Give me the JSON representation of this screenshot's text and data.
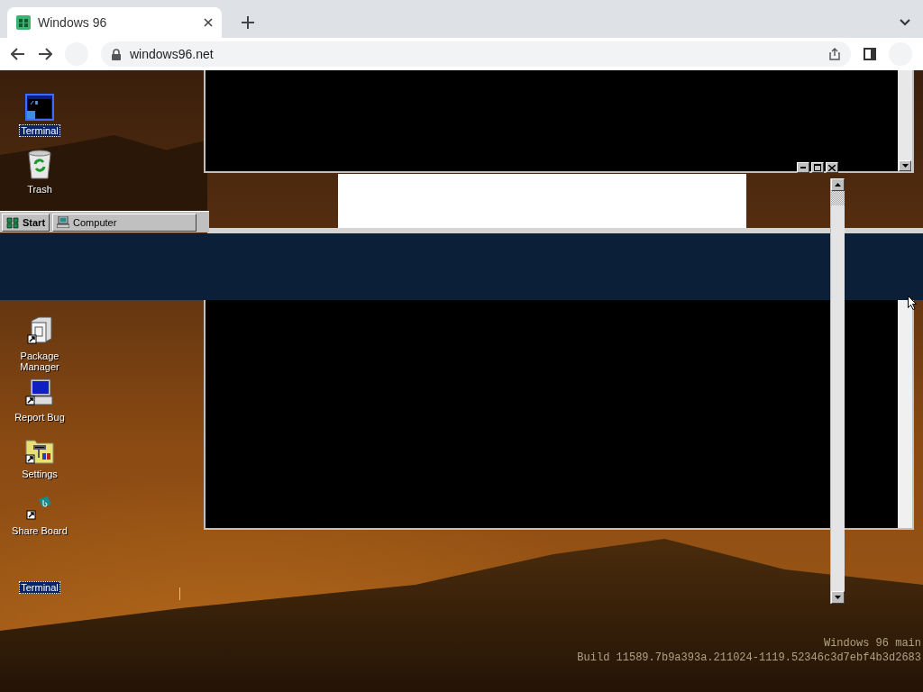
{
  "browser": {
    "tabs": [
      {
        "title": "Windows 96",
        "selected": true
      }
    ],
    "address": "windows96.net"
  },
  "desktop": {
    "icons": [
      {
        "kind": "terminal",
        "label": "Terminal",
        "selected": true
      },
      {
        "kind": "trash",
        "label": "Trash",
        "selected": false
      },
      {
        "kind": "package",
        "label": "Package Manager",
        "selected": false
      },
      {
        "kind": "bug",
        "label": "Report Bug",
        "selected": false
      },
      {
        "kind": "settings",
        "label": "Settings",
        "selected": false
      },
      {
        "kind": "share",
        "label": "Share Board",
        "selected": false
      },
      {
        "kind": "none",
        "label": "Terminal",
        "selected": true
      }
    ],
    "taskbar": {
      "start": "Start",
      "tasks": [
        {
          "label": "Computer",
          "selected": false
        }
      ]
    },
    "build_info": [
      "Windows 96 main",
      "Build 11589.7b9a393a.211024-1119.52346c3d7ebf4b3d2683"
    ]
  }
}
